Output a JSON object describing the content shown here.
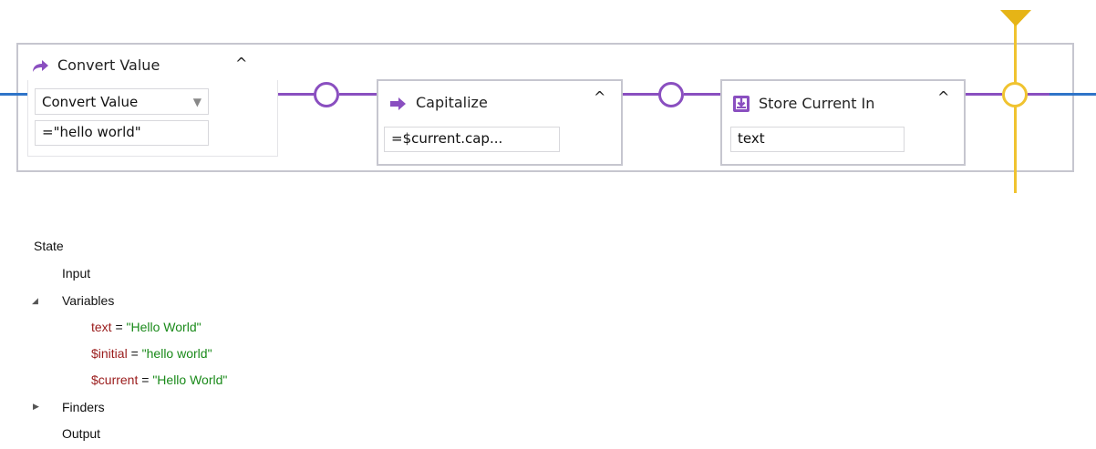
{
  "workflow": {
    "blocks": [
      {
        "title": "Convert Value",
        "icon": "arrow-redo-icon",
        "collapse_glyph": "^",
        "dropdown_value": "Convert Value",
        "dropdown_arrow": "▼",
        "field_value": "=\"hello world\""
      },
      {
        "title": "Capitalize",
        "icon": "arrow-right-icon",
        "collapse_glyph": "^",
        "field_value": "=$current.cap..."
      },
      {
        "title": "Store Current In",
        "icon": "download-box-icon",
        "collapse_glyph": "^",
        "field_value": "text"
      }
    ],
    "colors": {
      "connector": "#8a4fc0",
      "input_line": "#2f74c8",
      "cursor_line": "#f0c330",
      "border": "#c6c6cf"
    }
  },
  "state_tree": {
    "root_label": "State",
    "input_label": "Input",
    "variables_label": "Variables",
    "variables_toggle": "◢",
    "variables": [
      {
        "name": "text",
        "eq": " = ",
        "value": "\"Hello World\""
      },
      {
        "name": "$initial",
        "eq": " = ",
        "value": "\"hello world\""
      },
      {
        "name": "$current",
        "eq": " = ",
        "value": "\"Hello World\""
      }
    ],
    "finders_label": "Finders",
    "finders_toggle": "▶",
    "output_label": "Output"
  }
}
